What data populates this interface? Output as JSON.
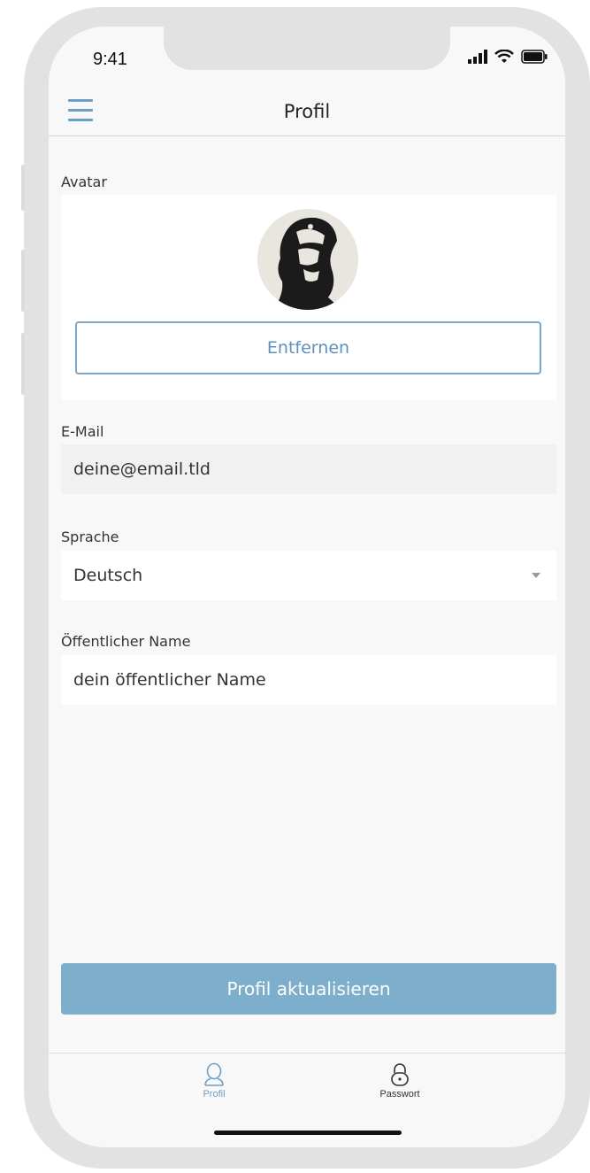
{
  "status_bar": {
    "time": "9:41"
  },
  "nav": {
    "title": "Profil"
  },
  "avatar_section": {
    "label": "Avatar",
    "remove_label": "Entfernen"
  },
  "email": {
    "label": "E-Mail",
    "value": "deine@email.tld"
  },
  "language": {
    "label": "Sprache",
    "selected": "Deutsch"
  },
  "public_name": {
    "label": "Öffentlicher Name",
    "value": "dein öffentlicher Name"
  },
  "update_label": "Profil aktualisieren",
  "tabs": [
    {
      "label": "Profil",
      "icon": "user-icon",
      "active": true
    },
    {
      "label": "Passwort",
      "icon": "lock-icon",
      "active": false
    }
  ],
  "colors": {
    "accent": "#6aa0c8",
    "primary_button": "#7daecb",
    "background": "#f8f8f8",
    "frame": "#e2e2e2"
  }
}
